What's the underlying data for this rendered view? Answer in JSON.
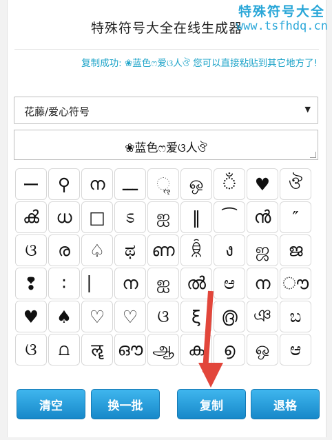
{
  "header": {
    "title": "特殊符号大全在线生成器"
  },
  "watermark": {
    "name": "特殊符号大全",
    "url": "www.tsfhdq.cn"
  },
  "status": {
    "message": "复制成功: ❀蓝色ෆ爱ଓ人ঔ 您可以直接粘贴到其它地方了!"
  },
  "category_select": {
    "value": "花藤/爱心符号"
  },
  "preview": {
    "text": "❀蓝色ෆ爱ଓ人ঔ"
  },
  "symbols": [
    "ー",
    "⚲",
    "ന",
    "ـــ",
    "ૣ",
    "ஒ",
    "ঁ",
    "♥",
    "ঔ",
    "ൿ",
    "ധ",
    "□",
    "ಽ",
    "ஐ",
    "‖",
    "⁀",
    "ൻ",
    "″",
    "ଓ",
    "ര",
    "♤",
    "ಥ",
    "ണ",
    "ꌊ",
    "ง",
    "ஜ",
    "ജ",
    "❢",
    "∶",
    "⎸",
    "ന",
    "ஐ",
    "ൽ",
    "ಆ",
    "ന",
    "ൗ",
    "♥",
    "♠",
    "♡",
    "♡",
    "ଓ",
    "ξ",
    "൫",
    "ঞ",
    "ಬ",
    "ଓ",
    "⩍",
    "ॡ",
    "ഔ",
    "ஆ",
    "ക",
    "൭",
    "ஒ",
    "ಆ"
  ],
  "buttons": {
    "clear": "清空",
    "swap": "换一批",
    "copy": "复制",
    "back": "退格"
  },
  "colors": {
    "accent": "#2aa7d8",
    "button": "#2196dc",
    "arrow": "#e2463b"
  }
}
